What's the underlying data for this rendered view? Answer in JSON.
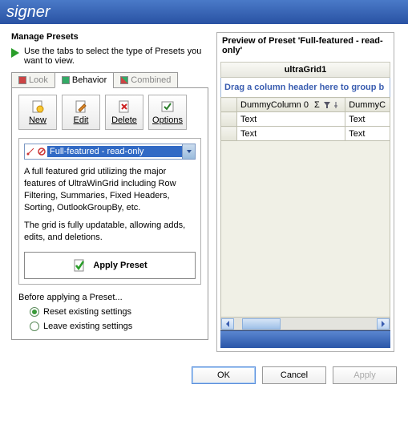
{
  "window": {
    "title_fragment": "signer"
  },
  "left": {
    "section_title": "Manage Presets",
    "hint": "Use the tabs to select the type of Presets you want to view.",
    "tabs": {
      "look": "Look",
      "behavior": "Behavior",
      "combined": "Combined"
    },
    "toolbar": {
      "new": "New",
      "edit": "Edit",
      "delete": "Delete",
      "options": "Options"
    },
    "preset": {
      "selected": "Full-featured - read-only",
      "desc1": "A full featured grid utilizing the major features of UltraWinGrid including Row Filtering, Summaries, Fixed Headers, Sorting, OutlookGroupBy, etc.",
      "desc2": "The grid is fully updatable, allowing adds, edits, and deletions.",
      "apply_label": "Apply Preset"
    },
    "before": {
      "label": "Before applying a Preset...",
      "reset": "Reset existing settings",
      "leave": "Leave existing settings"
    }
  },
  "preview": {
    "title": "Preview of Preset 'Full-featured - read-only'",
    "grid_caption": "ultraGrid1",
    "group_by": "Drag a column header here to group b",
    "columns": [
      "DummyColumn 0",
      "DummyC"
    ],
    "rows": [
      [
        "Text",
        "Text"
      ],
      [
        "Text",
        "Text"
      ]
    ]
  },
  "buttons": {
    "ok": "OK",
    "cancel": "Cancel",
    "apply": "Apply"
  }
}
